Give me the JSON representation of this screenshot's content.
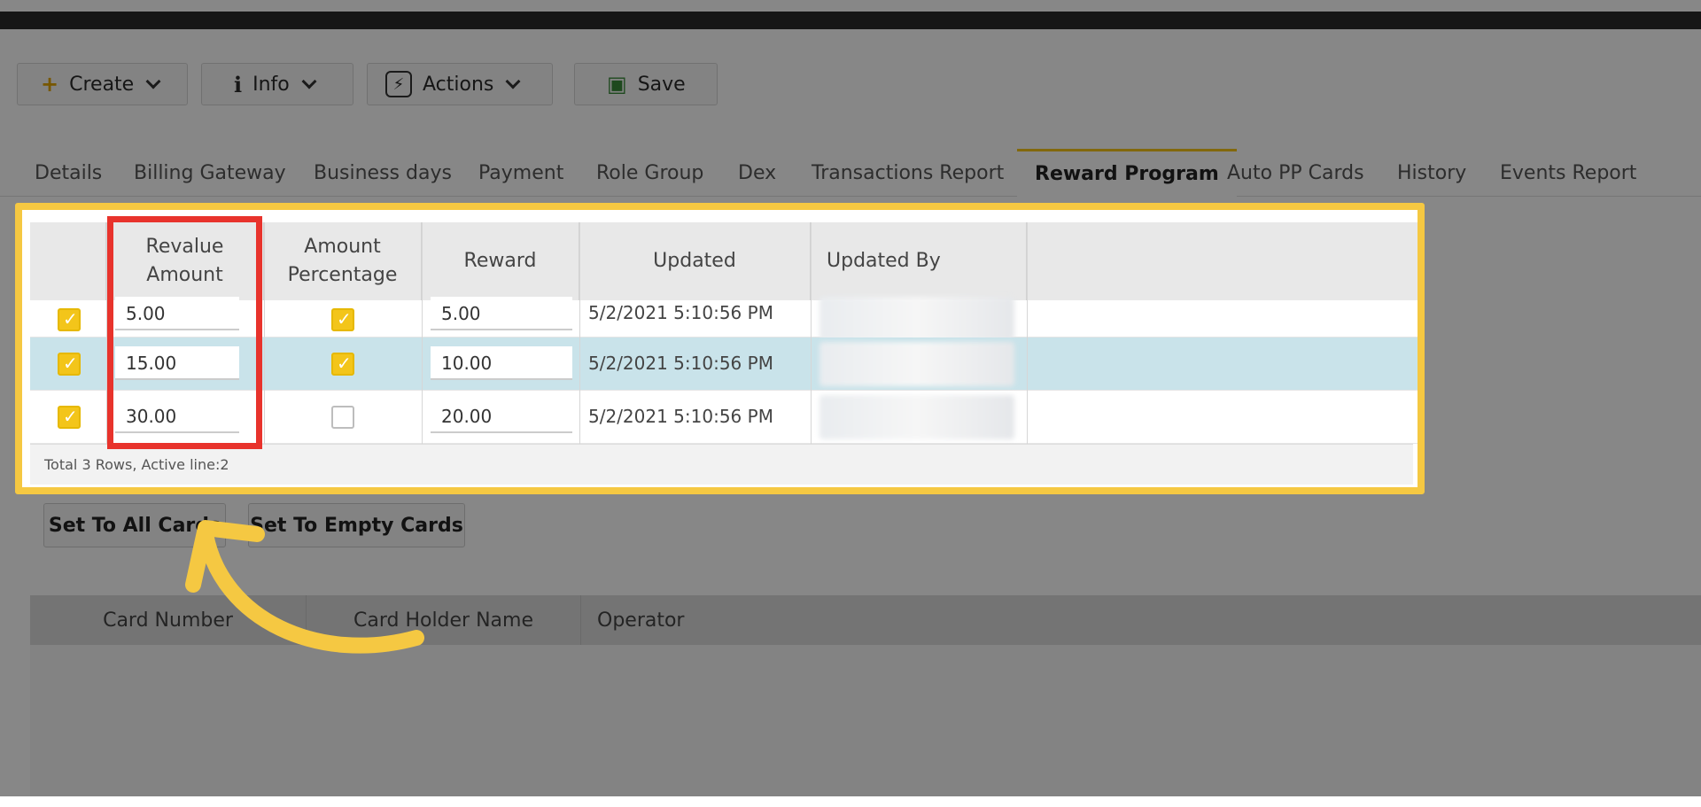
{
  "toolbar": {
    "create_label": "Create",
    "info_label": "Info",
    "actions_label": "Actions",
    "save_label": "Save",
    "icons": {
      "create": "plus-icon",
      "info": "info-icon",
      "actions": "bolt-icon",
      "save": "floppy-disk-icon"
    }
  },
  "tabs": [
    {
      "label": "Details"
    },
    {
      "label": "Billing Gateway"
    },
    {
      "label": "Business days"
    },
    {
      "label": "Payment"
    },
    {
      "label": "Role Group"
    },
    {
      "label": "Dex"
    },
    {
      "label": "Transactions Report"
    },
    {
      "label": "Reward Program",
      "active": true
    },
    {
      "label": "Auto PP Cards"
    },
    {
      "label": "History"
    },
    {
      "label": "Events Report"
    }
  ],
  "reward_grid": {
    "headers": {
      "revalue": "Revalue Amount",
      "amount_percentage": "Amount Percentage",
      "reward": "Reward",
      "updated": "Updated",
      "updated_by": "Updated By"
    },
    "rows": [
      {
        "selected": true,
        "revalue": "5.00",
        "amount_percentage": true,
        "reward": "5.00",
        "updated": "5/2/2021 5:10:56 PM"
      },
      {
        "selected": true,
        "revalue": "15.00",
        "amount_percentage": true,
        "reward": "10.00",
        "updated": "5/2/2021 5:10:56 PM",
        "active": true
      },
      {
        "selected": true,
        "revalue": "30.00",
        "amount_percentage": false,
        "reward": "20.00",
        "updated": "5/2/2021 5:10:56 PM"
      }
    ],
    "footer": "Total 3 Rows, Active line:2"
  },
  "buttons": {
    "set_all": "Set To All Cards",
    "set_empty": "Set To Empty Cards"
  },
  "cards_grid": {
    "headers": {
      "card_number": "Card Number",
      "card_holder": "Card Holder Name",
      "operator": "Operator"
    }
  },
  "colors": {
    "highlight_frame": "#f5c842",
    "annotation_box": "#e8332c",
    "checkbox_on": "#f3c51a",
    "active_row": "#c9e3ea"
  }
}
